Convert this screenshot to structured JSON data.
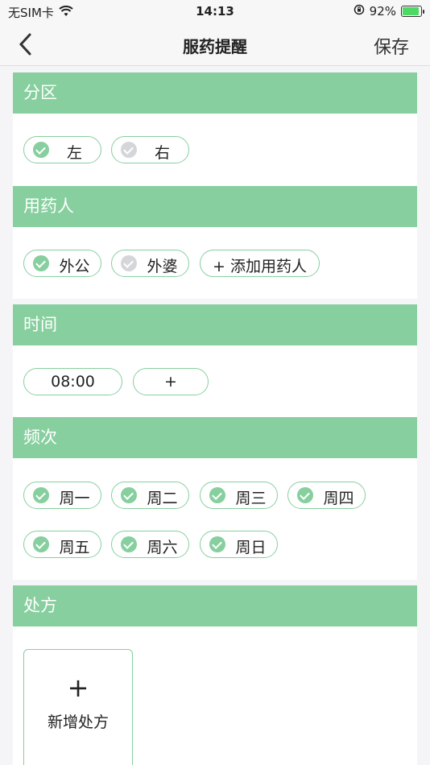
{
  "status": {
    "carrier": "无SIM卡",
    "time": "14:13",
    "battery": "92%",
    "battery_level": 0.92
  },
  "nav": {
    "back_icon": "chevron-left-icon",
    "title": "服药提醒",
    "save": "保存"
  },
  "sections": {
    "side": {
      "title": "分区",
      "options": [
        {
          "label": "左",
          "checked": true
        },
        {
          "label": "右",
          "checked": false
        }
      ]
    },
    "user": {
      "title": "用药人",
      "options": [
        {
          "label": "外公",
          "checked": true
        },
        {
          "label": "外婆",
          "checked": false
        }
      ],
      "add": "+ 添加用药人"
    },
    "time": {
      "title": "时间",
      "times": [
        "08:00"
      ],
      "add": "+"
    },
    "freq": {
      "title": "频次",
      "days": [
        "周一",
        "周二",
        "周三",
        "周四",
        "周五",
        "周六",
        "周日"
      ]
    },
    "rx": {
      "title": "处方",
      "add_icon": "+",
      "add": "新增处方"
    }
  },
  "colors": {
    "accent": "#87cf9e",
    "unchecked": "#d4d6da"
  }
}
